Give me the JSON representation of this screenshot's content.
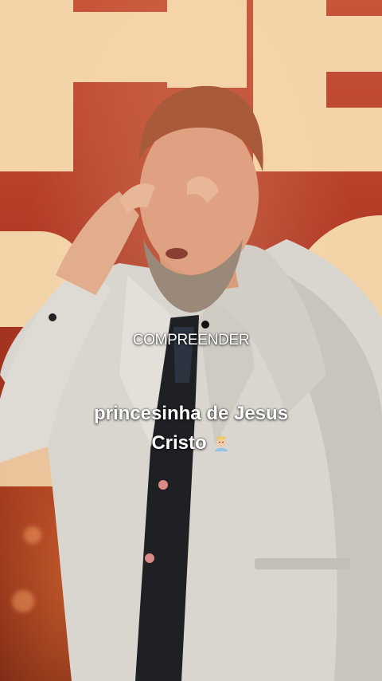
{
  "video": {
    "overlay_word": "COMPREENDER",
    "caption_line1": "princesinha de Jesus",
    "caption_line2": "Cristo",
    "caption_emoji": "princess-emoji-icon"
  },
  "colors": {
    "background_red": "#b23a26",
    "screen_letters": "#f3d3a8",
    "suit": "#d9d6cf",
    "caption_text": "#ffffff"
  }
}
